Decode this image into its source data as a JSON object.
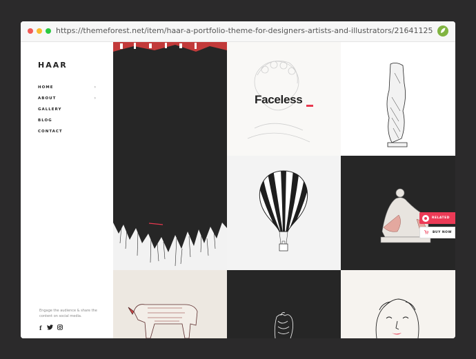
{
  "browser": {
    "url": "https://themeforest.net/item/haar-a-portfolio-theme-for-designers-artists-and-illustrators/21641125",
    "leaf_icon": "envato-leaf-icon",
    "leaf_color": "#81b441"
  },
  "sidebar": {
    "logo": "HAAR",
    "nav": [
      {
        "label": "HOME",
        "has_submenu": true
      },
      {
        "label": "ABOUT",
        "has_submenu": true
      },
      {
        "label": "GALLERY",
        "has_submenu": false
      },
      {
        "label": "BLOG",
        "has_submenu": false
      },
      {
        "label": "CONTACT",
        "has_submenu": false
      }
    ],
    "chevron": "›",
    "share_text": "Engage the audience & share the content on social media.",
    "social": [
      {
        "icon": "facebook-icon",
        "glyph": "f"
      },
      {
        "icon": "twitter-icon",
        "glyph": "✦"
      },
      {
        "icon": "instagram-icon",
        "glyph": "◎"
      }
    ]
  },
  "gallery": {
    "tiles": [
      {
        "name": "ink-brush-stroke",
        "bg": "#262626"
      },
      {
        "name": "faceless-tile",
        "bg": "#f9f8f6",
        "title": "Faceless",
        "accent": "#e8384f"
      },
      {
        "name": "headless-statue",
        "bg": "#ffffff"
      },
      {
        "name": "striped-hot-air-balloon",
        "bg": "#f3f3f3"
      },
      {
        "name": "reclining-sculpture",
        "bg": "#262626"
      },
      {
        "name": "wolf-engraving",
        "bg": "#ede8e1"
      },
      {
        "name": "line-art-hand",
        "bg": "#262626"
      },
      {
        "name": "classical-bust",
        "bg": "#f6f3ef"
      }
    ]
  },
  "floating": {
    "related_label": "RELATED",
    "buy_label": "BUY NOW",
    "accent": "#ec3a56"
  }
}
